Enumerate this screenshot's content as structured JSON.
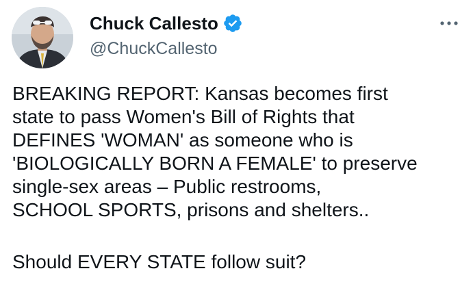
{
  "author": {
    "display_name": "Chuck Callesto",
    "handle": "@ChuckCallesto",
    "verified": true,
    "verified_color": "#1d9bf0",
    "avatar_icon": "profile-photo"
  },
  "menu": {
    "icon": "more-options-icon"
  },
  "tweet": {
    "lines": [
      "BREAKING REPORT: Kansas becomes first",
      "state to pass Women's Bill of Rights that",
      "DEFINES 'WOMAN' as someone who is",
      "'BIOLOGICALLY BORN A FEMALE' to preserve",
      "single-sex areas – Public restrooms,",
      "SCHOOL SPORTS, prisons and shelters.."
    ],
    "question": "Should EVERY STATE follow suit?"
  }
}
